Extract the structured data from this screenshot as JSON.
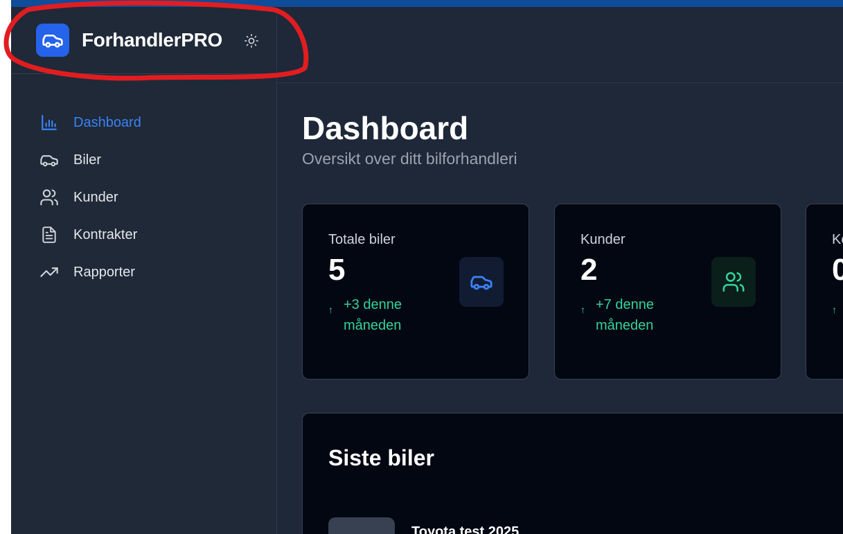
{
  "app": {
    "name": "ForhandlerPRO",
    "accent_color": "#2563eb"
  },
  "sidebar": {
    "items": [
      {
        "label": "Dashboard",
        "icon": "bar-chart-icon",
        "active": true
      },
      {
        "label": "Biler",
        "icon": "car-icon",
        "active": false
      },
      {
        "label": "Kunder",
        "icon": "users-icon",
        "active": false
      },
      {
        "label": "Kontrakter",
        "icon": "file-text-icon",
        "active": false
      },
      {
        "label": "Rapporter",
        "icon": "trending-up-icon",
        "active": false
      }
    ]
  },
  "page": {
    "title": "Dashboard",
    "subtitle": "Oversikt over ditt bilforhandleri"
  },
  "stats": [
    {
      "label": "Totale biler",
      "value": "5",
      "trend": "+3 denne måneden",
      "icon": "car-icon",
      "icon_color": "#3b82f6"
    },
    {
      "label": "Kunder",
      "value": "2",
      "trend": "+7 denne måneden",
      "icon": "users-icon",
      "icon_color": "#34d399"
    },
    {
      "label": "Ko",
      "value": "0",
      "trend": "",
      "icon": "",
      "icon_color": ""
    }
  ],
  "recent": {
    "title": "Siste biler",
    "items": [
      {
        "name": "Toyota test 2025"
      }
    ]
  },
  "colors": {
    "sidebar_bg": "#1f2937",
    "main_bg": "#1e2838",
    "card_bg": "#030712",
    "trend_green": "#34d399",
    "annotation_red": "#e11d21"
  }
}
